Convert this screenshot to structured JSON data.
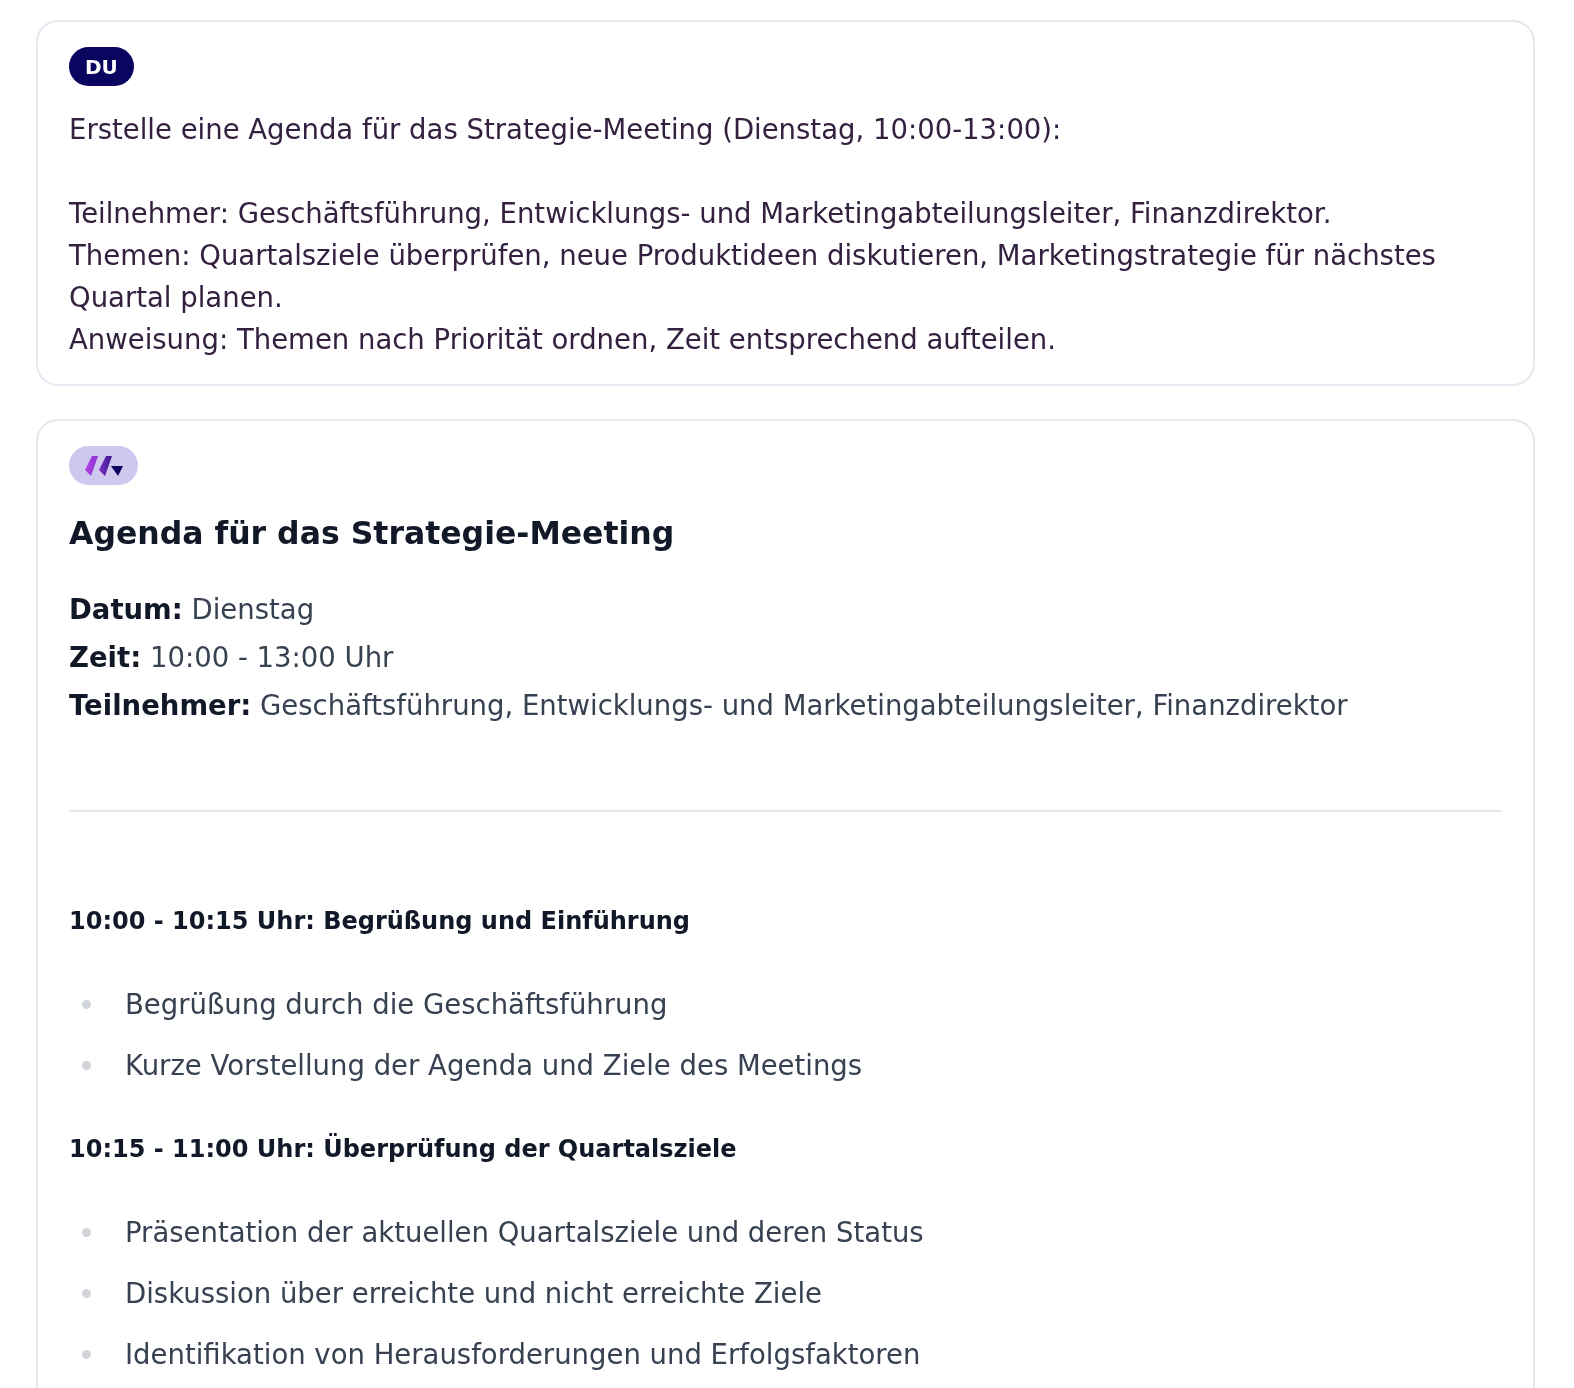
{
  "user_message": {
    "badge": "DU",
    "paragraphs": [
      [
        "Erstelle eine Agenda für das Strategie-Meeting (Dienstag, 10:00-13:00):"
      ],
      [
        "Teilnehmer: Geschäftsführung, Entwicklungs- und Marketingabteilungsleiter, Finanzdirektor.",
        "Themen: Quartalsziele überprüfen, neue Produktideen diskutieren, Marketingstrategie für nächstes Quartal planen.",
        "Anweisung: Themen nach Priorität ordnen, Zeit entsprechend aufteilen."
      ]
    ]
  },
  "assistant_message": {
    "title": "Agenda für das Strategie-Meeting",
    "details": [
      "**Datum:** Dienstag",
      "**Zeit:** 10:00 - 13:00 Uhr",
      "**Teilnehmer:** Geschäftsführung, Entwicklungs- und Marketingabteilungsleiter, Finanzdirektor"
    ],
    "sections": [
      {
        "heading": "10:00 - 10:15 Uhr: Begrüßung und Einführung",
        "items": [
          "Begrüßung durch die Geschäftsführung",
          "Kurze Vorstellung der Agenda und Ziele des Meetings"
        ]
      },
      {
        "heading": "10:15 - 11:00 Uhr: Überprüfung der Quartalsziele",
        "items": [
          "Präsentation der aktuellen Quartalsziele und deren Status",
          "Diskussion über erreichte und nicht erreichte Ziele",
          "Identifikation von Herausforderungen und Erfolgsfaktoren"
        ]
      }
    ]
  }
}
